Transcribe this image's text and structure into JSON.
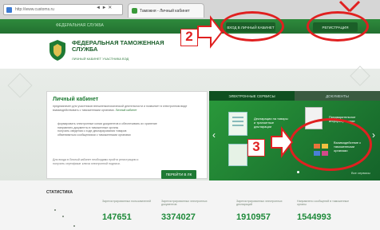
{
  "browser": {
    "address_text": "http://www.customs.ru",
    "nav_buttons": "◄ ► ✕",
    "tab_label": "Таможня - Личный кабинет"
  },
  "site": {
    "topbar_label": "ФЕДЕРАЛЬНАЯ СЛУЖБА",
    "login_label": "ВХОД В ЛИЧНЫЙ КАБИНЕТ",
    "register_label": "РЕГИСТРАЦИЯ",
    "logo_title": "ФЕДЕРАЛЬНАЯ ТАМОЖЕННАЯ СЛУЖБА",
    "logo_subtitle": "ЛИЧНЫЙ КАБИНЕТ УЧАСТНИКА ВЭД"
  },
  "personal_cabinet": {
    "title": "Личный кабинет",
    "intro": "предназначен для участников внешнеэкономической деятельности и позволяет в электронном виде взаимодействовать с таможенными органами.",
    "link_text": "Личный кабинет",
    "items": [
      "формировать электронные копии документов и обеспечивать их хранение",
      "направлять документы в таможенные органы",
      "получать сведения о ходе декларирования товаров",
      "обмениваться сообщениями с таможенными органами"
    ],
    "footer": "Для входа в Личный кабинет необходимо пройти регистрацию и получить сертификат ключа электронной подписи.",
    "button_label": "ПЕРЕЙТИ В ЛК"
  },
  "green_panel": {
    "tabs": [
      "ЭЛЕКТРОННЫЕ СЕРВИСЫ",
      "ДОКУМЕНТЫ"
    ],
    "services": [
      "Декларации на товары и транзитные декларации",
      "Предварительное информирование",
      "Электронные копии документов",
      "Взаимодействие с таможенными органами"
    ],
    "more_label": "Все сервисы"
  },
  "statistics": {
    "title": "СТАТИСТИКА",
    "items": [
      {
        "caption": "Зарегистрированных пользователей",
        "value": "147651"
      },
      {
        "caption": "Зарегистрированных электронных документов",
        "value": "3374027"
      },
      {
        "caption": "Зарегистрированных электронных деклараций",
        "value": "1910957"
      },
      {
        "caption": "Направлено сообщений в таможенные органы",
        "value": "1544993"
      }
    ]
  },
  "annotations": [
    {
      "label": "2"
    },
    {
      "label": "3"
    }
  ],
  "colors": {
    "brand_green": "#1f7a34",
    "annotation_red": "#e02020"
  }
}
